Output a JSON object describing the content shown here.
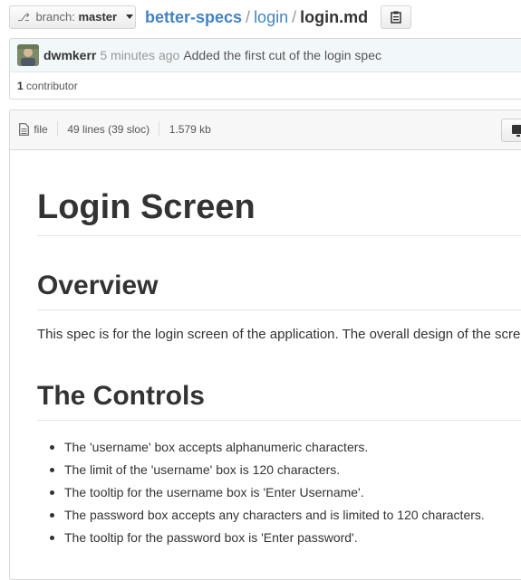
{
  "branch": {
    "prefix": "branch:",
    "name": "master",
    "icon": "branch-icon"
  },
  "breadcrumb": {
    "repo": "better-specs",
    "separator": "/",
    "folder": "login",
    "file": "login.md"
  },
  "clipboard": {
    "icon": "clipboard-icon"
  },
  "commit": {
    "author": "dwmkerr",
    "time": "5 minutes ago",
    "message": "Added the first cut of the login spec",
    "contributors_count": "1",
    "contributors_label": "contributor"
  },
  "file": {
    "label": "file",
    "lines": "49 lines (39 sloc)",
    "size": "1.579 kb",
    "raw_icon": "desktop-icon"
  },
  "content": {
    "title": "Login Screen",
    "overview_heading": "Overview",
    "overview_text": "This spec is for the login screen of the application. The overall design of the screen",
    "controls_heading": "The Controls",
    "controls": [
      "The 'username' box accepts alphanumeric characters.",
      "The limit of the 'username' box is 120 characters.",
      "The tooltip for the username box is 'Enter Username'.",
      "The password box accepts any characters and is limited to 120 characters.",
      "The tooltip for the password box is 'Enter password'."
    ]
  },
  "colors": {
    "link": "#4183c4",
    "text": "#333333",
    "muted": "#999999",
    "commit_bg": "#f2f8fa"
  }
}
